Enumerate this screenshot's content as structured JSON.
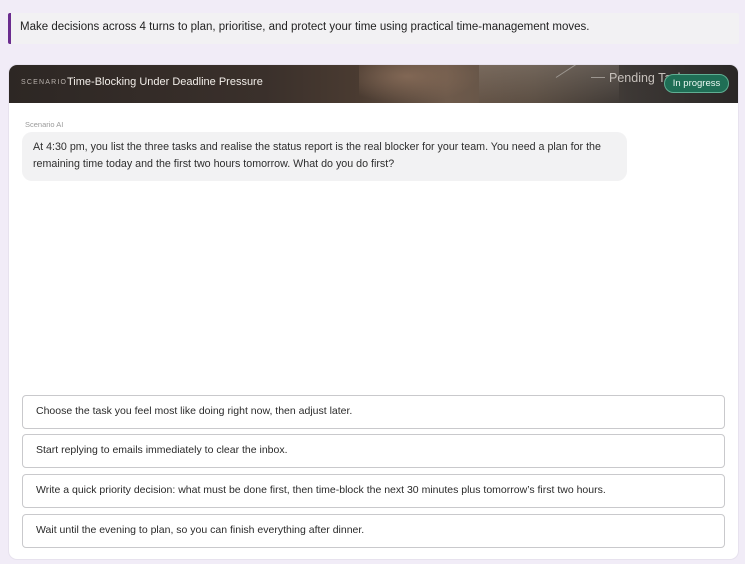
{
  "intro": {
    "text": "Make decisions across 4 turns to plan, prioritise, and protect your time using practical time-management moves."
  },
  "scenario": {
    "kicker": "Scenario",
    "title": "Time-Blocking Under Deadline Pressure",
    "image_caption": "Pending Task",
    "status": "In progress",
    "status_color": "#1f6e55"
  },
  "conversation": {
    "speaker": "Scenario AI",
    "message": "At 4:30 pm, you list the three tasks and realise the status report is the real blocker for your team. You need a plan for the remaining time today and the first two hours tomorrow. What do you do first?"
  },
  "choices": [
    "Choose the task you feel most like doing right now, then adjust later.",
    "Start replying to emails immediately to clear the inbox.",
    "Write a quick priority decision: what must be done first, then time-block the next 30 minutes plus tomorrow’s first two hours.",
    "Wait until the evening to plan, so you can finish everything after dinner."
  ],
  "accent_color": "#6b2c8f"
}
